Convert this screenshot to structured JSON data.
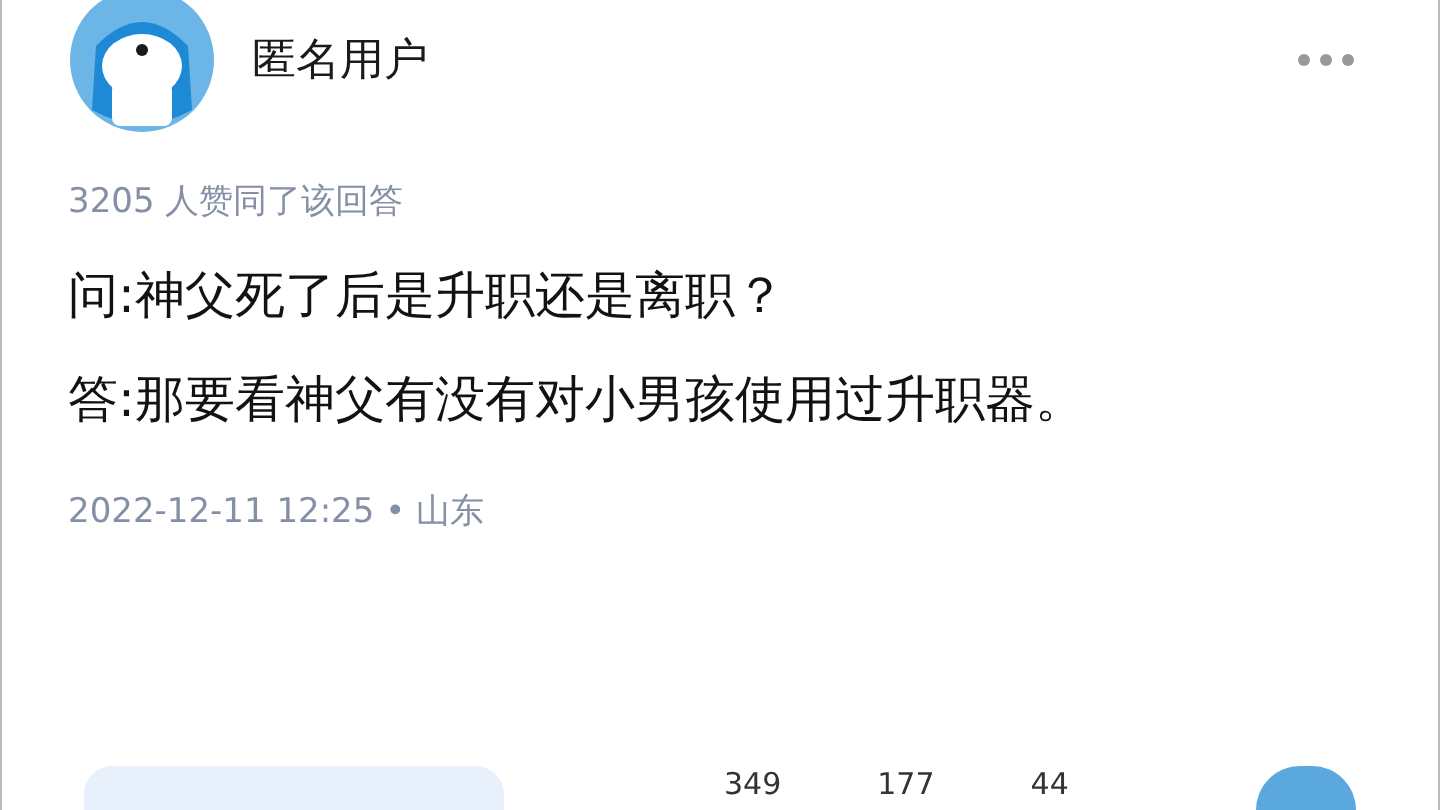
{
  "author": {
    "name": "匿名用户"
  },
  "upvote_note": "3205 人赞同了该回答",
  "paragraphs": [
    "问:神父死了后是升职还是离职？",
    "答:那要看神父有没有对小男孩使用过升职器。"
  ],
  "meta": "2022-12-11 12:25 • 山东",
  "action_counts": [
    "349",
    "177",
    "44"
  ]
}
